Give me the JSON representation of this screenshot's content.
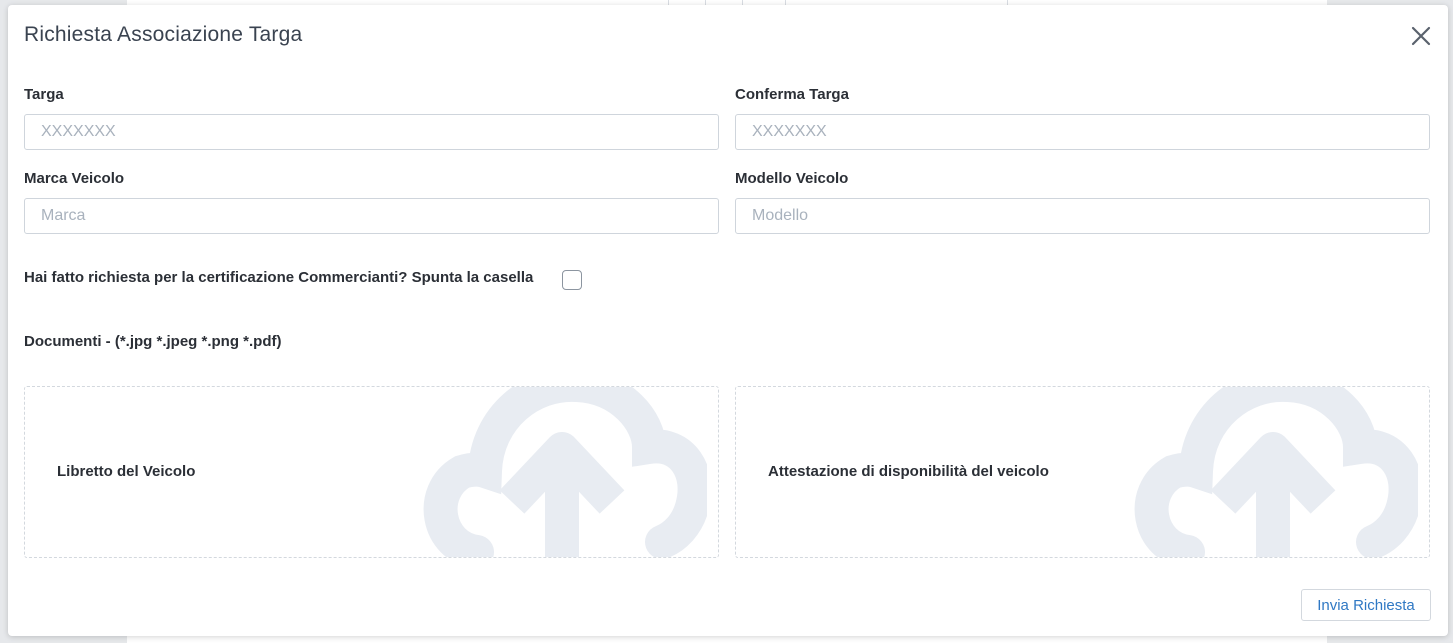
{
  "modal": {
    "title": "Richiesta Associazione Targa",
    "close_icon": "close-icon"
  },
  "fields": {
    "targa": {
      "label": "Targa",
      "placeholder": "XXXXXXX",
      "value": ""
    },
    "conferma_targa": {
      "label": "Conferma Targa",
      "placeholder": "XXXXXXX",
      "value": ""
    },
    "marca": {
      "label": "Marca Veicolo",
      "placeholder": "Marca",
      "value": ""
    },
    "modello": {
      "label": "Modello Veicolo",
      "placeholder": "Modello",
      "value": ""
    }
  },
  "commercianti": {
    "question": "Hai fatto richiesta per la certificazione Commercianti? Spunta la casella",
    "checked": false
  },
  "documents": {
    "label": "Documenti - (*.jpg *.jpeg *.png *.pdf)",
    "uploads": [
      {
        "label": "Libretto del Veicolo",
        "icon": "cloud-upload-icon"
      },
      {
        "label": "Attestazione di disponibilità del veicolo",
        "icon": "cloud-upload-icon"
      }
    ]
  },
  "actions": {
    "submit_label": "Invia Richiesta"
  },
  "colors": {
    "accent": "#2f78c4",
    "cloud_icon": "#e8ecf2",
    "title_text": "#3a4350"
  }
}
